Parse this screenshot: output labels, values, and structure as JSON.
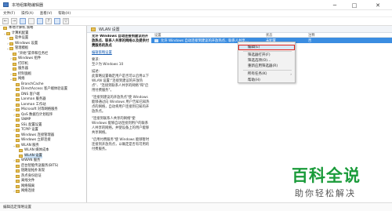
{
  "window": {
    "title": "本地组策略编辑器",
    "controls": {
      "minimize": "─",
      "maximize": "□",
      "close": "✕"
    }
  },
  "menubar": {
    "items": [
      "文件(F)",
      "操作(A)",
      "查看(V)",
      "帮助(H)"
    ]
  },
  "toolbar": {
    "icons": [
      "back-icon",
      "forward-icon",
      "folder-icon",
      "view-icon",
      "export-icon",
      "help-icon",
      "properties-icon",
      "filter-icon"
    ]
  },
  "tree": {
    "items": [
      {
        "label": "本地计算机 策略",
        "toggle": ""
      },
      {
        "label": "计算机配置",
        "toggle": "⌄"
      },
      {
        "label": "软件设置",
        "toggle": "›"
      },
      {
        "label": "Windows 设置",
        "toggle": "›"
      },
      {
        "label": "管理模板",
        "toggle": "⌄"
      },
      {
        "label": "\"开始\"菜单和任务栏",
        "toggle": ""
      },
      {
        "label": "Windows 组件",
        "toggle": "›"
      },
      {
        "label": "打印机",
        "toggle": ""
      },
      {
        "label": "服务器",
        "toggle": ""
      },
      {
        "label": "控制面板",
        "toggle": "›"
      },
      {
        "label": "网络",
        "toggle": "⌄"
      },
      {
        "label": "BranchCache",
        "toggle": ""
      },
      {
        "label": "DirectAccess 客户端体验设置",
        "toggle": ""
      },
      {
        "label": "DNS 客户端",
        "toggle": ""
      },
      {
        "label": "Lanman 服务器",
        "toggle": ""
      },
      {
        "label": "Lanman 工作站",
        "toggle": ""
      },
      {
        "label": "Microsoft 对等网络服务",
        "toggle": "›"
      },
      {
        "label": "QoS 数据包计划程序",
        "toggle": "›"
      },
      {
        "label": "SNMP",
        "toggle": ""
      },
      {
        "label": "SSL 配置设置",
        "toggle": ""
      },
      {
        "label": "TCPIP 设置",
        "toggle": "›"
      },
      {
        "label": "Windows 连接管理器",
        "toggle": ""
      },
      {
        "label": "Windows 立即连接",
        "toggle": ""
      },
      {
        "label": "WLAN 服务",
        "toggle": "⌄"
      },
      {
        "label": "WLAN 媒体成本",
        "toggle": ""
      },
      {
        "label": "WLAN 设置",
        "toggle": ""
      },
      {
        "label": "WWAN 服务",
        "toggle": "›"
      },
      {
        "label": "后台智能传送服务(BITS)",
        "toggle": ""
      },
      {
        "label": "链路层拓扑发现",
        "toggle": ""
      },
      {
        "label": "热点身份验证",
        "toggle": ""
      },
      {
        "label": "离线文件",
        "toggle": ""
      },
      {
        "label": "网络隔离",
        "toggle": ""
      },
      {
        "label": "网络连接",
        "toggle": "›"
      }
    ],
    "selected_index": 25
  },
  "panel": {
    "title": "WLAN 设置",
    "description": {
      "setting_name": "允许 Windows 自动连接到建议的开放热点、联系人共享的网络以及提供付费服务的热点",
      "edit_link": "编辑策略设置",
      "requirements_label": "要求:",
      "requirements": "至少为 Windows 10",
      "description_label": "描述:",
      "p1": "此策略设置确定用户是否可以启用以下 WLAN 设置:\"连接到建议的开放热点\"、\"连接到联系人共享的网络\"和\"启用付费服务\"。",
      "p2": "\"连接到建议的开放热点\"使 Windows 能够通过向 Windows 用户告知已知热点的网络，自动将用户连接到已知的开放热点。",
      "p3": "\"连接到联系人共享的网络\"使 Windows 能够自动连接到用户的联系人共享的网络，并使设备上的用户能够共享网络。",
      "p4": "\"启用付费服务\"使 Windows 能够暂时连接到开放热点，以确定是否有可用的付费服务。"
    },
    "columns": {
      "setting": "设置",
      "state": "状态",
      "note": "注释"
    },
    "rows": [
      {
        "setting": "允许 Windows 自动连接到建议的开放热点、联系人共享...",
        "state": "未配置",
        "note": "否"
      }
    ]
  },
  "context_menu": {
    "items": [
      {
        "label": "编辑(E)",
        "highlight": true,
        "has_submenu": false
      },
      {
        "label": "筛选器打开(F)",
        "highlight": false,
        "has_submenu": false
      },
      {
        "label": "筛选选项(O)...",
        "highlight": false,
        "has_submenu": false
      },
      {
        "label": "重新应用筛选器(R)",
        "highlight": false,
        "has_submenu": false
      },
      {
        "label": "所有任务(K)",
        "highlight": false,
        "has_submenu": true
      },
      {
        "label": "帮助(H)",
        "highlight": false,
        "has_submenu": false
      }
    ],
    "submenu_arrow": "›"
  },
  "statusbar": {
    "text": "编辑选定策略设置"
  },
  "watermark": {
    "main": "百科全说",
    "sub": "助你轻松解决"
  },
  "colors": {
    "selection_blue": "#3b8de1",
    "highlight_red": "#e2231a",
    "watermark_green": "#1a9b3a"
  }
}
